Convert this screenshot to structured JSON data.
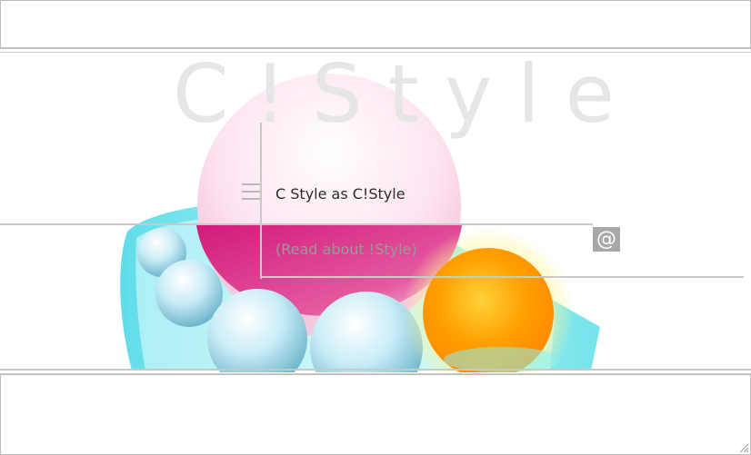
{
  "watermark": "C!Style",
  "title": "C Style as C!Style",
  "read_link": "(Read about !Style)",
  "at_button_label": "@",
  "colors": {
    "background": "#ffffff",
    "lines": "#c8c8c8",
    "pink_sphere": "#e7238a",
    "cyan_sphere": "#9fe8f5",
    "orange_sphere": "#ffa600"
  },
  "icons": [
    "menu-icon",
    "resize-grip-icon"
  ]
}
